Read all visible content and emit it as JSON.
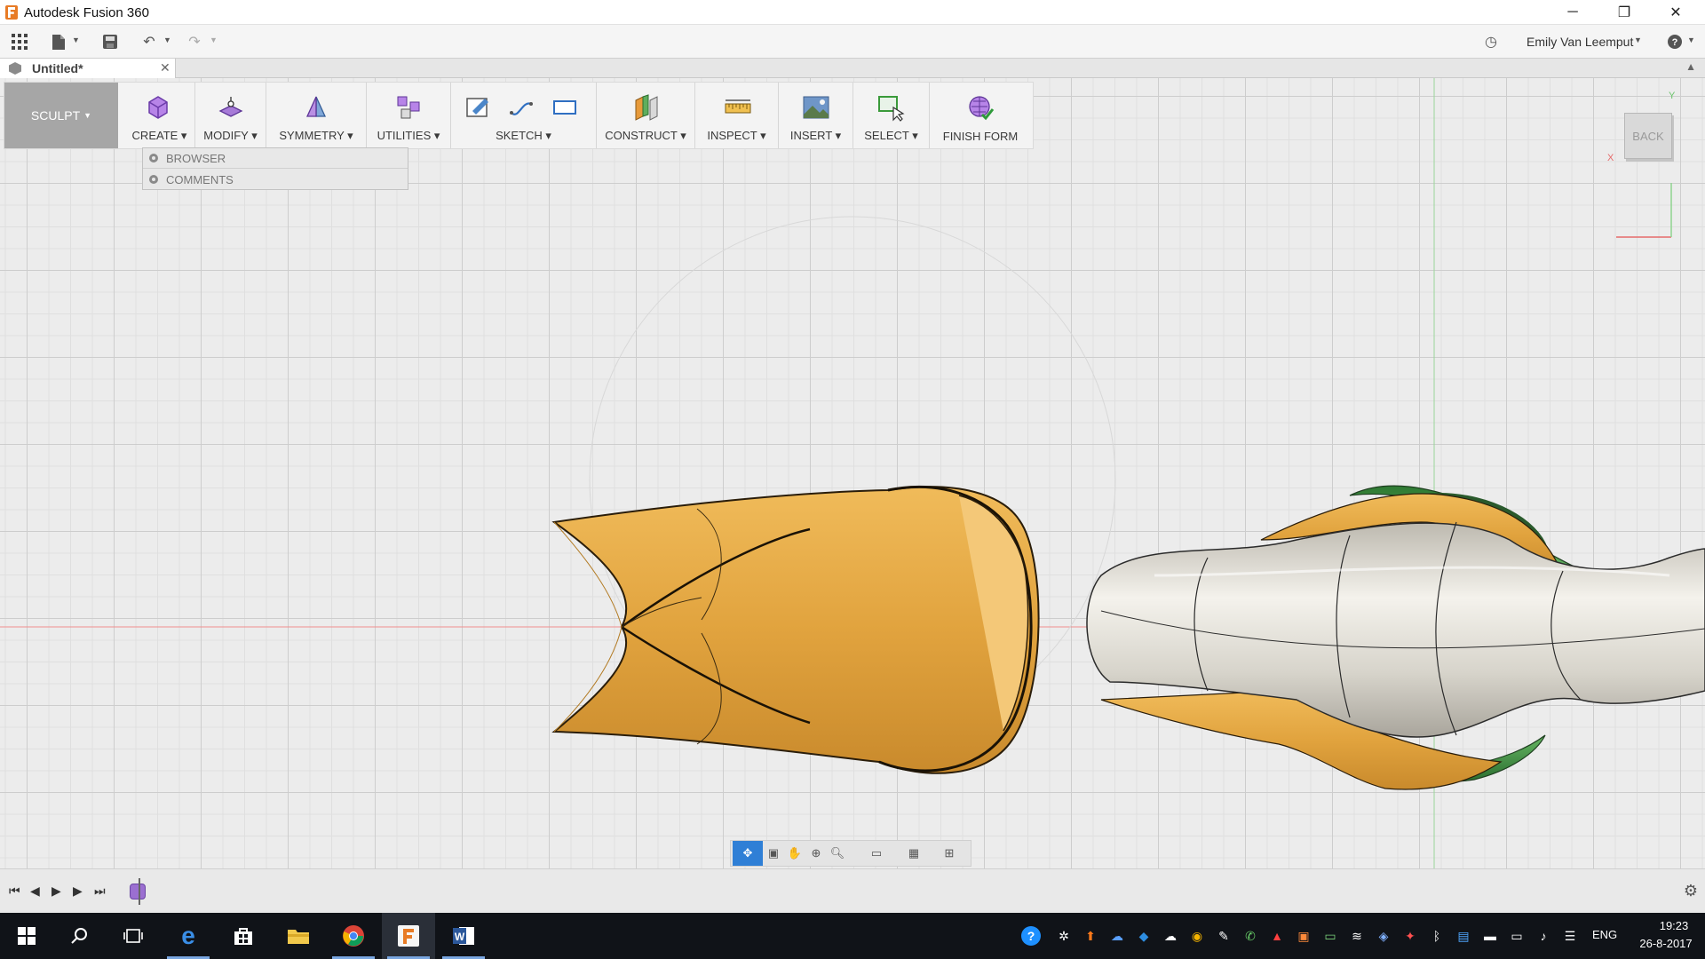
{
  "window": {
    "title": "Autodesk Fusion 360",
    "minimize": "─",
    "restore": "❐",
    "close": "✕"
  },
  "quick_access": {
    "user_name": "Emily Van Leemput",
    "icons": [
      "apps-grid-icon",
      "file-icon",
      "save-icon",
      "undo-icon",
      "redo-icon",
      "job-status-icon",
      "help-icon"
    ]
  },
  "document_tab": {
    "label": "Untitled*",
    "close": "✕"
  },
  "toolbar": {
    "workspace": "SCULPT",
    "groups": [
      {
        "label": "CREATE"
      },
      {
        "label": "MODIFY"
      },
      {
        "label": "SYMMETRY"
      },
      {
        "label": "UTILITIES"
      },
      {
        "label": "SKETCH"
      },
      {
        "label": "CONSTRUCT"
      },
      {
        "label": "INSPECT"
      },
      {
        "label": "INSERT"
      },
      {
        "label": "SELECT"
      },
      {
        "label": "FINISH FORM"
      }
    ]
  },
  "browser_panel": {
    "rows": [
      {
        "label": "BROWSER"
      },
      {
        "label": "COMMENTS"
      }
    ]
  },
  "viewcube": {
    "face": "BACK",
    "axis_y": "Y",
    "axis_x": "X"
  },
  "colors": {
    "accent": "#1f6fc5",
    "gold_body": "#e3a43f",
    "silver_body": "#d8d5cd",
    "green_body": "#4a9a4c",
    "taskbar": "#101318"
  },
  "timeline": {
    "buttons": [
      "first-icon",
      "previous-icon",
      "play-icon",
      "next-icon",
      "last-icon"
    ]
  },
  "taskbar": {
    "language": "ENG",
    "time": "19:23",
    "date": "26-8-2017"
  }
}
